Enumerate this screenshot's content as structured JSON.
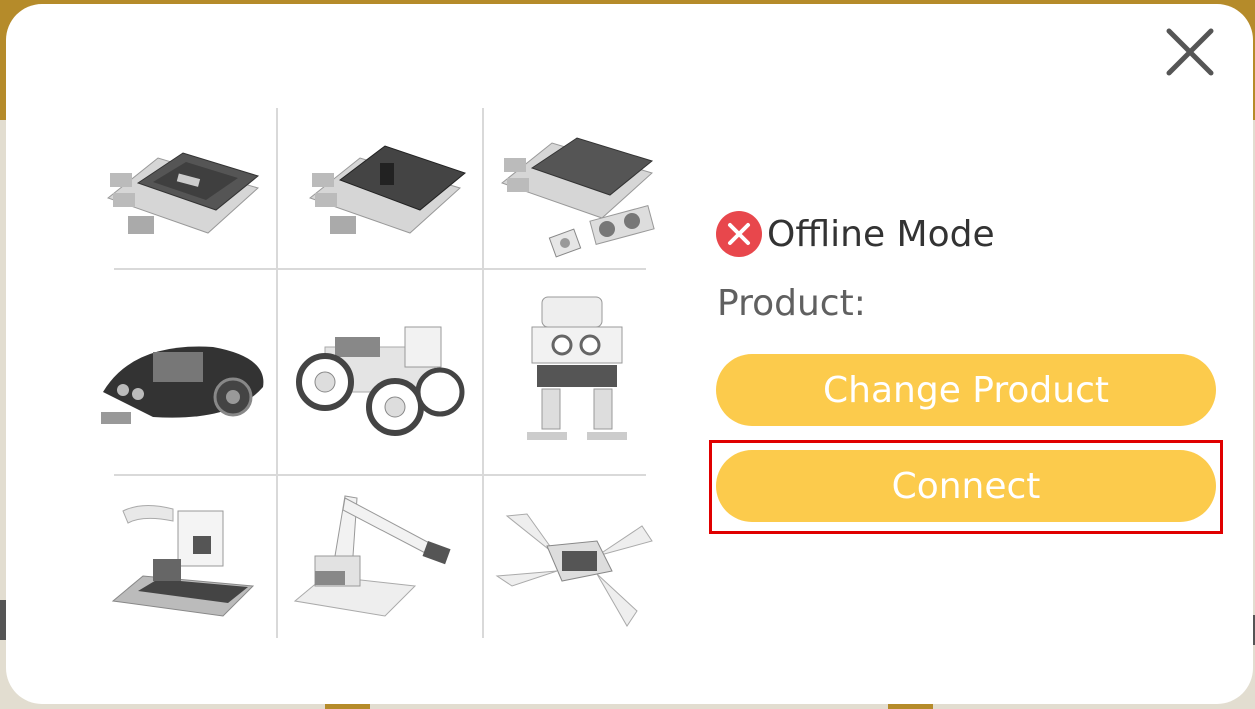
{
  "status": {
    "icon": "error-x-icon",
    "text": "Offline Mode",
    "icon_color": "#e8474c"
  },
  "product": {
    "label": "Product:"
  },
  "buttons": {
    "change_product": "Change Product",
    "connect": "Connect",
    "color": "#fccb4c"
  },
  "highlight_color": "#e00000",
  "product_images": [
    "expansion-board-icon",
    "battery-board-icon",
    "sensor-kit-icon",
    "tank-robot-icon",
    "four-wheel-car-icon",
    "biped-robot-icon",
    "camera-module-icon",
    "robot-arm-icon",
    "spider-robot-icon"
  ]
}
